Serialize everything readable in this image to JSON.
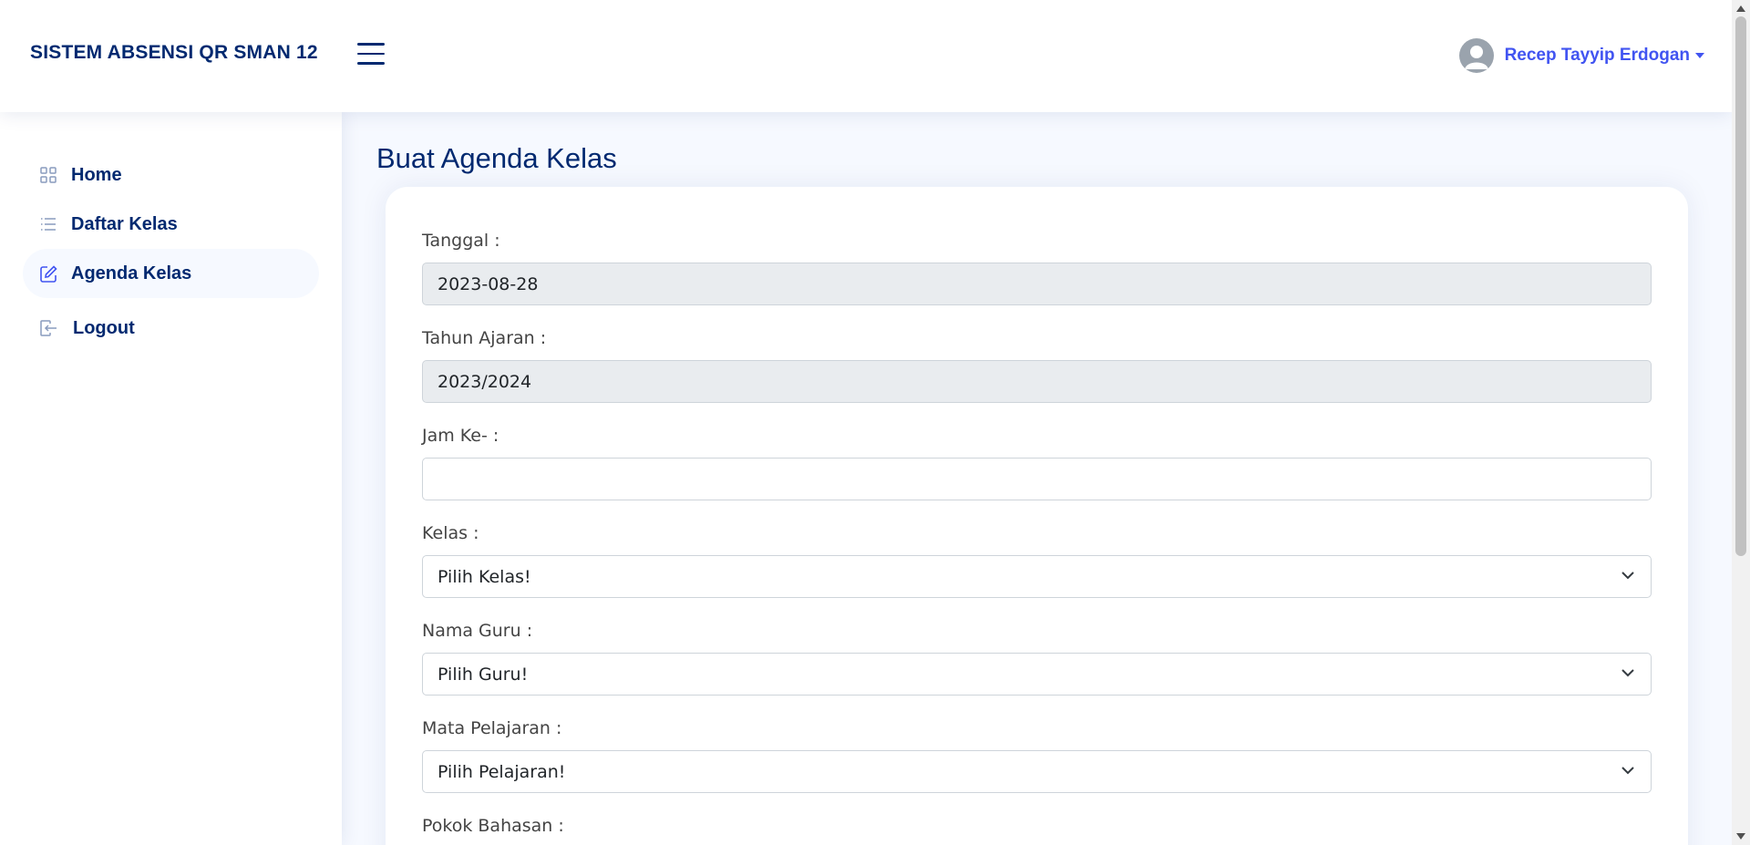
{
  "header": {
    "brand": "SISTEM ABSENSI QR SMAN 12",
    "menu_icon": "hamburger-icon",
    "user_name": "Recep Tayyip Erdogan",
    "avatar_icon": "user-avatar-icon"
  },
  "sidebar": {
    "items": [
      {
        "label": "Home",
        "icon": "grid-icon",
        "active": false
      },
      {
        "label": "Daftar Kelas",
        "icon": "list-icon",
        "active": false
      },
      {
        "label": "Agenda Kelas",
        "icon": "edit-icon",
        "active": true
      },
      {
        "label": "Logout",
        "icon": "logout-icon",
        "active": false
      }
    ]
  },
  "main": {
    "title": "Buat Agenda Kelas",
    "form": {
      "tanggal": {
        "label": "Tanggal :",
        "value": "2023-08-28"
      },
      "tahun_ajaran": {
        "label": "Tahun Ajaran :",
        "value": "2023/2024"
      },
      "jam_ke": {
        "label": "Jam Ke- :",
        "value": ""
      },
      "kelas": {
        "label": "Kelas :",
        "value": "Pilih Kelas!"
      },
      "nama_guru": {
        "label": "Nama Guru :",
        "value": "Pilih Guru!"
      },
      "mata_pelajaran": {
        "label": "Mata Pelajaran :",
        "value": "Pilih Pelajaran!"
      },
      "pokok_bahasan": {
        "label": "Pokok Bahasan :"
      }
    }
  },
  "colors": {
    "primary": "#4154f1",
    "navy": "#012970",
    "background": "#f6f9ff",
    "readonly_bg": "#e9ecef"
  }
}
